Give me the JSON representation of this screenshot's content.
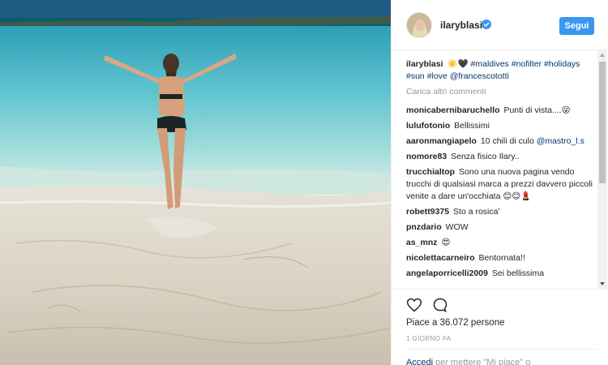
{
  "post": {
    "username": "ilaryblasi",
    "follow_label": "Segui",
    "caption_user": "ilaryblasi",
    "caption_text": "☀️🖤",
    "caption_tags": [
      "#maldives",
      "#nofilter",
      "#holidays",
      "#sun",
      "#love",
      "@francescototti"
    ],
    "load_more": "Carica altri commenti"
  },
  "comments": [
    {
      "user": "monicabernibaruchello",
      "text": "Punti di vista....😜"
    },
    {
      "user": "lulufotonio",
      "text": "Bellissimi"
    },
    {
      "user": "aaronmangiapelo",
      "text": "10 chili di culo",
      "mention": "@mastro_l.s"
    },
    {
      "user": "nomore83",
      "text": "Senza fisico Ilary.."
    },
    {
      "user": "trucchialtop",
      "text": "Sono una nuova pagina vendo trucchi di qualsiasi marca a prezzi davvero piccoli venite a dare un'occhiata 😊😊💄"
    },
    {
      "user": "robett9375",
      "text": "Sto a rosica'"
    },
    {
      "user": "pnzdario",
      "text": "WOW"
    },
    {
      "user": "as_mnz",
      "text": "😍"
    },
    {
      "user": "nicolettacarneiro",
      "text": "Bentornata!!"
    },
    {
      "user": "angelaporricelli2009",
      "text": "Sei bellissima"
    }
  ],
  "footer": {
    "likes": "Piace a 36.072 persone",
    "time": "1 GIORNO FA",
    "login_link": "Accedi",
    "login_text": "per mettere \"Mi piace\" o"
  },
  "colors": {
    "accent": "#3897f0",
    "link": "#003569",
    "muted": "#999999"
  },
  "icons": [
    "verified-badge-icon",
    "heart-icon",
    "comment-icon"
  ]
}
